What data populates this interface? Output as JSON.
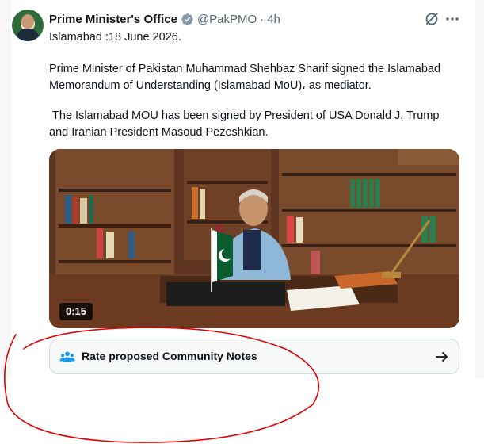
{
  "post": {
    "author_name": "Prime Minister's Office",
    "handle": "@PakPMO",
    "separator": "·",
    "time": "4h",
    "lines": [
      "Islamabad :18 June 2026.",
      "Prime Minister of Pakistan Muhammad Shehbaz Sharif signed the Islamabad Memorandum of Understanding (Islamabad MoU)، as mediator.",
      " The Islamabad MOU has been signed by President of USA Donald J. Trump and Iranian President Masoud Pezeshkian."
    ],
    "video_duration": "0:15",
    "community_notes_label": "Rate proposed Community Notes"
  },
  "icons": {
    "verified": "verified-badge-icon",
    "grok": "grok-icon",
    "more": "more-icon",
    "notes": "people-icon",
    "arrow": "arrow-right-icon"
  },
  "colors": {
    "verified": "#829aab",
    "text": "#0f1419",
    "muted": "#536471",
    "annotation": "#e00000"
  }
}
